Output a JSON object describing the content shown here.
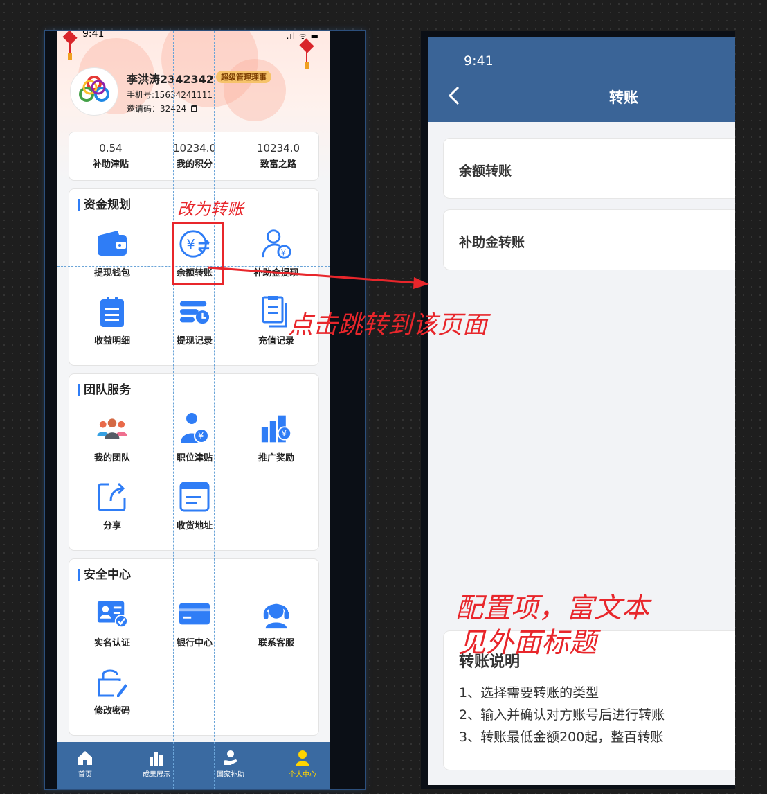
{
  "left_phone": {
    "status": {
      "time": "9:41",
      "icons": ".ıl ᯤ ▬"
    },
    "user": {
      "name": "李洪涛2342342",
      "badge": "超级管理理事",
      "phone_label": "手机号:15634241111",
      "invite_label": "邀请码：32424",
      "copy_icon": "copy-icon"
    },
    "stats": [
      {
        "value": "0.54",
        "label": "补助津贴"
      },
      {
        "value": "10234.0",
        "label": "我的积分"
      },
      {
        "value": "10234.0",
        "label": "致富之路"
      }
    ],
    "sections": {
      "funds": {
        "title": "资金规划",
        "items": [
          {
            "label": "提现钱包",
            "icon": "wallet-icon"
          },
          {
            "label": "余额转账",
            "icon": "yuan-transfer-icon"
          },
          {
            "label": "补助金提现",
            "icon": "user-yuan-icon"
          },
          {
            "label": "收益明细",
            "icon": "clipboard-list-icon"
          },
          {
            "label": "提现记录",
            "icon": "record-clock-icon"
          },
          {
            "label": "充值记录",
            "icon": "document-copy-icon"
          }
        ]
      },
      "team": {
        "title": "团队服务",
        "items": [
          {
            "label": "我的团队",
            "icon": "team-people-icon"
          },
          {
            "label": "职位津贴",
            "icon": "user-yuan-icon"
          },
          {
            "label": "推广奖励",
            "icon": "bar-chart-yuan-icon"
          },
          {
            "label": "分享",
            "icon": "share-icon"
          },
          {
            "label": "收货地址",
            "icon": "address-card-icon"
          }
        ]
      },
      "security": {
        "title": "安全中心",
        "items": [
          {
            "label": "实名认证",
            "icon": "id-card-check-icon"
          },
          {
            "label": "银行中心",
            "icon": "bank-card-icon"
          },
          {
            "label": "联系客服",
            "icon": "headset-support-icon"
          },
          {
            "label": "修改密码",
            "icon": "lock-edit-icon"
          }
        ]
      }
    },
    "tabbar": [
      {
        "label": "首页",
        "icon": "home-icon"
      },
      {
        "label": "成果展示",
        "icon": "bar-chart-icon"
      },
      {
        "label": "国家补助",
        "icon": "hand-subsidy-icon"
      },
      {
        "label": "个人中心",
        "icon": "person-icon",
        "active": true
      }
    ]
  },
  "right_phone": {
    "status": {
      "time": "9:41"
    },
    "title": "转账",
    "options": [
      "余额转账",
      "补助金转账"
    ],
    "description": {
      "title": "转账说明",
      "lines": [
        "1、选择需要转账的类型",
        "2、输入并确认对方账号后进行转账",
        "3、转账最低金额200起，整百转账"
      ]
    }
  },
  "annotations": {
    "rename": "改为转账",
    "jump": "点击跳转到该页面",
    "config_line1": "配置项，富文本",
    "config_line2": "见外面标题",
    "color": "#e8262b"
  },
  "colors": {
    "primary_blue": "#2f7df6",
    "header_blue": "#3a6497",
    "tabbar_blue": "#3a6aa1",
    "active_tab": "#ffd400",
    "badge_bg": "#f6c36a"
  }
}
